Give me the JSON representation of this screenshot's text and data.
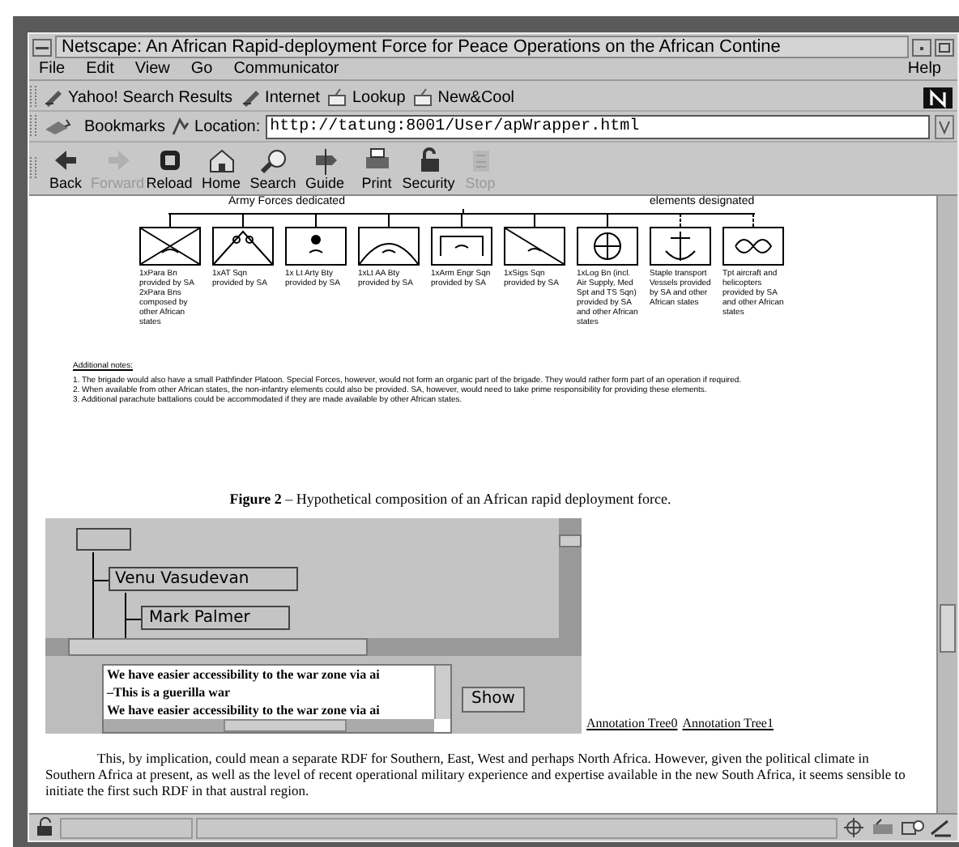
{
  "window": {
    "title": "Netscape: An African Rapid-deployment Force for Peace Operations on the African Contine"
  },
  "menu": [
    "File",
    "Edit",
    "View",
    "Go",
    "Communicator"
  ],
  "help_menu": "Help",
  "personal_toolbar": [
    {
      "label": "Yahoo! Search Results",
      "kind": "bookmark"
    },
    {
      "label": "Internet",
      "kind": "bookmark"
    },
    {
      "label": "Lookup",
      "kind": "folder"
    },
    {
      "label": "New&Cool",
      "kind": "folder"
    }
  ],
  "location_bar": {
    "bookmarks": "Bookmarks",
    "label": "Location:",
    "value": "http://tatung:8001/User/apWrapper.html"
  },
  "navigation": [
    {
      "label": "Back",
      "disabled": false
    },
    {
      "label": "Forward",
      "disabled": true
    },
    {
      "label": "Reload",
      "disabled": false
    },
    {
      "label": "Home",
      "disabled": false
    },
    {
      "label": "Search",
      "disabled": false
    },
    {
      "label": "Guide",
      "disabled": false
    },
    {
      "label": "Print",
      "disabled": false
    },
    {
      "label": "Security",
      "disabled": false
    },
    {
      "label": "Stop",
      "disabled": true
    }
  ],
  "figure": {
    "left_heading": "Army Forces dedicated",
    "right_heading": "elements designated",
    "units": [
      {
        "caption": "1xPara Bn provided by SA 2xPara Bns composed by other African states"
      },
      {
        "caption": "1xAT Sqn provided by SA"
      },
      {
        "caption": "1x Lt Arty Bty provided by SA"
      },
      {
        "caption": "1xLt AA Bty provided by SA"
      },
      {
        "caption": "1xArm Engr Sqn provided by SA"
      },
      {
        "caption": "1xSigs Sqn provided by SA"
      },
      {
        "caption": "1xLog Bn (incl. Air Supply, Med Spt and TS Sqn) provided by SA and other African states"
      },
      {
        "caption": "Staple transport Vessels provided by SA and other African states"
      },
      {
        "caption": "Tpt aircraft and helicopters provided by SA and other African states"
      }
    ],
    "notes_title": "Additional notes:",
    "notes": [
      "1. The brigade would also have a small Pathfinder Platoon. Special Forces, however, would not form an organic part of the brigade. They would rather form part of an operation if required.",
      "2. When available from other African states, the non-infantry elements could also be provided. SA, however, would need to take prime responsibility for providing these elements.",
      "3. Additional parachute battalions could be accommodated if they are made available by other African states."
    ]
  },
  "caption": "**Figure 2** – Hypothetical composition of an African rapid deployment force.",
  "applet": {
    "tree": {
      "children": [
        {
          "label": "Venu Vasudevan",
          "children": [
            {
              "label": "Mark Palmer"
            }
          ]
        }
      ]
    },
    "annotations": [
      {
        "text": "We have easier accessibility to the war zone via ai"
      },
      {
        "text": "–This is a guerilla war"
      },
      {
        "text": "We have easier accessibility to the war zone via ai"
      }
    ],
    "show_button": "Show"
  },
  "links": [
    "Annotation Tree0",
    "Annotation Tree1"
  ],
  "paragraph": "This, by implication, could mean a separate RDF for Southern, East, West and perhaps North Africa. However, given the political climate in Southern Africa at present, as well as the level of recent operational military experience and expertise available in the new South Africa, it seems sensible to initiate the first such RDF in that austral region."
}
